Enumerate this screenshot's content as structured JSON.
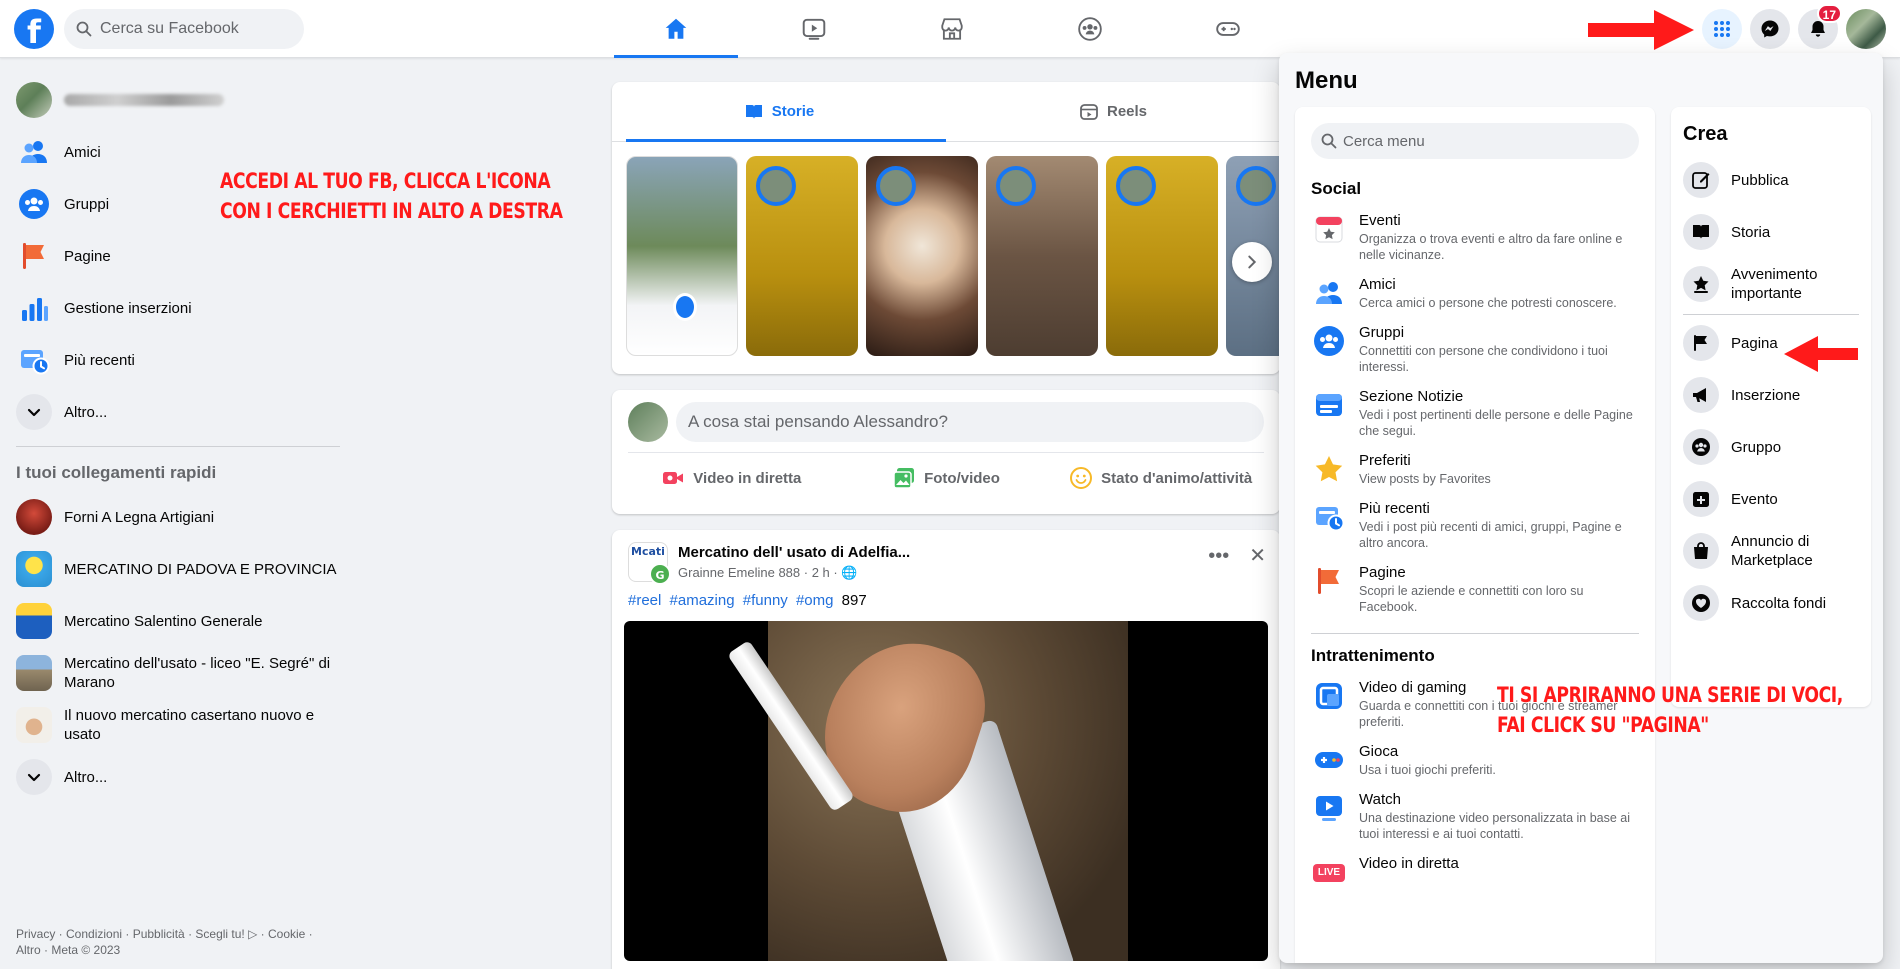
{
  "topbar": {
    "search_placeholder": "Cerca su Facebook",
    "notifications_count": "17"
  },
  "sidebar": {
    "items": [
      {
        "label": "Amici",
        "icon": "friends-icon"
      },
      {
        "label": "Gruppi",
        "icon": "groups-icon"
      },
      {
        "label": "Pagine",
        "icon": "pages-icon"
      },
      {
        "label": "Gestione inserzioni",
        "icon": "ads-manager-icon"
      },
      {
        "label": "Più recenti",
        "icon": "most-recent-icon"
      },
      {
        "label": "Altro...",
        "icon": "chevron-down-icon"
      }
    ],
    "shortcuts_heading": "I tuoi collegamenti rapidi",
    "shortcuts": [
      {
        "label": "Forni A Legna Artigiani"
      },
      {
        "label": "MERCATINO DI PADOVA E PROVINCIA"
      },
      {
        "label": "Mercatino Salentino Generale"
      },
      {
        "label": "Mercatino dell'usato - liceo \"E. Segré\" di Marano"
      },
      {
        "label": "Il nuovo mercatino casertano nuovo e usato"
      }
    ],
    "shortcuts_more": "Altro...",
    "footer_line1": "Privacy · Condizioni · Pubblicità · Scegli tu! ▷ · Cookie ·",
    "footer_line2": "Altro · Meta © 2023"
  },
  "annotations": {
    "first_line1": "ACCEDI AL TUO FB, CLICCA L'ICONA",
    "first_line2": "CON I CERCHIETTI IN ALTO A DESTRA",
    "second_line1": "TI SI APRIRANNO UNA SERIE DI VOCI,",
    "second_line2": "FAI CLICK SU \"PAGINA\"",
    "color": "#ff1a1a"
  },
  "feed": {
    "tabs": {
      "stories": "Storie",
      "reels": "Reels"
    },
    "composer_placeholder": "A cosa stai pensando Alessandro?",
    "composer_actions": {
      "live": "Video in diretta",
      "photo": "Foto/video",
      "feeling": "Stato d'animo/attività"
    },
    "post": {
      "title": "Mercatino dell' usato di Adelfia...",
      "author": "Grainne Emeline 888",
      "time": "2 h",
      "avatar_text": "Mcati",
      "avatar_badge": "G",
      "hashtags": [
        "#reel",
        "#amazing",
        "#funny",
        "#omg"
      ],
      "count": "897"
    }
  },
  "menu": {
    "title": "Menu",
    "search_placeholder": "Cerca menu",
    "social_heading": "Social",
    "social_items": [
      {
        "title": "Eventi",
        "desc": "Organizza o trova eventi e altro da fare online e nelle vicinanze."
      },
      {
        "title": "Amici",
        "desc": "Cerca amici o persone che potresti conoscere."
      },
      {
        "title": "Gruppi",
        "desc": "Connettiti con persone che condividono i tuoi interessi."
      },
      {
        "title": "Sezione Notizie",
        "desc": "Vedi i post pertinenti delle persone e delle Pagine che segui."
      },
      {
        "title": "Preferiti",
        "desc": "View posts by Favorites"
      },
      {
        "title": "Più recenti",
        "desc": "Vedi i post più recenti di amici, gruppi, Pagine e altro ancora."
      },
      {
        "title": "Pagine",
        "desc": "Scopri le aziende e connettiti con loro su Facebook."
      }
    ],
    "entertainment_heading": "Intrattenimento",
    "entertainment_items": [
      {
        "title": "Video di gaming",
        "desc": "Guarda e connettiti con i tuoi giochi e streamer preferiti."
      },
      {
        "title": "Gioca",
        "desc": "Usa i tuoi giochi preferiti."
      },
      {
        "title": "Watch",
        "desc": "Una destinazione video personalizzata in base ai tuoi interessi e ai tuoi contatti."
      },
      {
        "title": "Video in diretta",
        "desc": "",
        "badge": "LIVE"
      }
    ],
    "create_heading": "Crea",
    "create_items": [
      {
        "label": "Pubblica"
      },
      {
        "label": "Storia"
      },
      {
        "label": "Avvenimento importante"
      },
      {
        "label": "Pagina"
      },
      {
        "label": "Inserzione"
      },
      {
        "label": "Gruppo"
      },
      {
        "label": "Evento"
      },
      {
        "label": "Annuncio di Marketplace"
      },
      {
        "label": "Raccolta fondi"
      }
    ]
  },
  "colors": {
    "brand": "#1877f2",
    "background": "#f0f2f5",
    "badge": "#e41e3f"
  }
}
